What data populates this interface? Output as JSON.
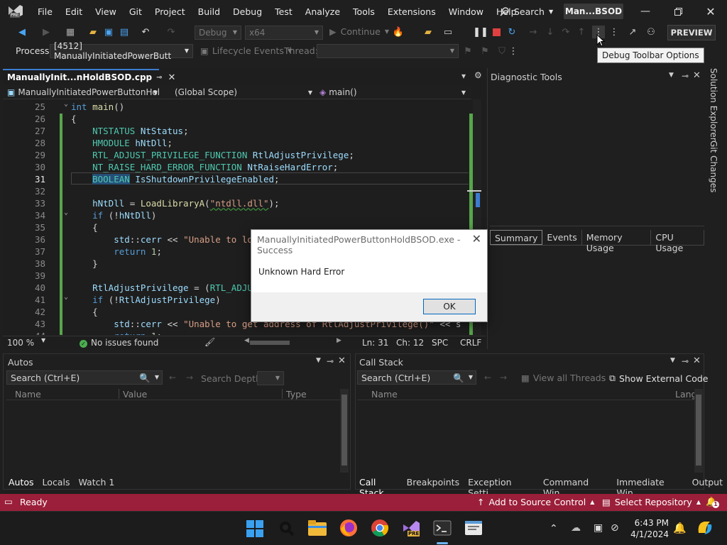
{
  "titlebar": {
    "menu": [
      "File",
      "Edit",
      "View",
      "Git",
      "Project",
      "Build",
      "Debug",
      "Test",
      "Analyze",
      "Tools",
      "Extensions",
      "Window",
      "Help"
    ],
    "search_label": "Search",
    "solution_badge": "Man...BSOD",
    "logo_badge": "PRE"
  },
  "toolbar": {
    "config_combo": "Debug",
    "platform_combo": "x64",
    "continue_label": "Continue",
    "preview_label": "PREVIEW",
    "tooltip": "Debug Toolbar Options"
  },
  "toolbar2": {
    "process_label": "Process:",
    "process_value": "[4512] ManuallyInitiatedPowerButt",
    "lifecycle_label": "Lifecycle Events",
    "thread_label": "Thread:"
  },
  "editor": {
    "tab_label": "ManuallyInit...nHoldBSOD.cpp",
    "nav_project": "ManuallyInitiatedPowerButtonHol",
    "nav_scope": "(Global Scope)",
    "nav_member": "main()",
    "current_line": "31",
    "lines": [
      {
        "n": "25",
        "t": [
          [
            "kw",
            "int"
          ],
          [
            "pl",
            " "
          ],
          [
            "fn",
            "main"
          ],
          [
            "pl",
            "()"
          ]
        ]
      },
      {
        "n": "26",
        "t": [
          [
            "pl",
            "{"
          ]
        ]
      },
      {
        "n": "27",
        "t": [
          [
            "pl",
            "    "
          ],
          [
            "ty",
            "NTSTATUS"
          ],
          [
            "pl",
            " "
          ],
          [
            "id",
            "NtStatus"
          ],
          [
            "pl",
            ";"
          ]
        ]
      },
      {
        "n": "28",
        "t": [
          [
            "pl",
            "    "
          ],
          [
            "ty",
            "HMODULE"
          ],
          [
            "pl",
            " "
          ],
          [
            "id",
            "hNtDll"
          ],
          [
            "pl",
            ";"
          ]
        ]
      },
      {
        "n": "29",
        "t": [
          [
            "pl",
            "    "
          ],
          [
            "ty",
            "RTL_ADJUST_PRIVILEGE_FUNCTION"
          ],
          [
            "pl",
            " "
          ],
          [
            "id",
            "RtlAdjustPrivilege"
          ],
          [
            "pl",
            ";"
          ]
        ]
      },
      {
        "n": "30",
        "t": [
          [
            "pl",
            "    "
          ],
          [
            "ty",
            "NT_RAISE_HARD_ERROR_FUNCTION"
          ],
          [
            "pl",
            " "
          ],
          [
            "id",
            "NtRaiseHardError"
          ],
          [
            "pl",
            ";"
          ]
        ]
      },
      {
        "n": "31",
        "t": [
          [
            "pl",
            "    "
          ],
          [
            "ty",
            "BOOLEAN"
          ],
          [
            "pl",
            " "
          ],
          [
            "id",
            "IsShutdownPrivilegeEnabled"
          ],
          [
            "pl",
            ";"
          ]
        ]
      },
      {
        "n": "32",
        "t": [
          [
            "pl",
            ""
          ]
        ]
      },
      {
        "n": "33",
        "t": [
          [
            "pl",
            "    "
          ],
          [
            "id",
            "hNtDll"
          ],
          [
            "pl",
            " = "
          ],
          [
            "fn",
            "LoadLibraryA"
          ],
          [
            "pl",
            "("
          ],
          [
            "st",
            "\"ntdll.dll\""
          ],
          [
            "pl",
            ");"
          ]
        ]
      },
      {
        "n": "34",
        "t": [
          [
            "pl",
            "    "
          ],
          [
            "kw",
            "if"
          ],
          [
            "pl",
            " (!"
          ],
          [
            "id",
            "hNtDll"
          ],
          [
            "pl",
            ")"
          ]
        ]
      },
      {
        "n": "35",
        "t": [
          [
            "pl",
            "    {"
          ]
        ]
      },
      {
        "n": "36",
        "t": [
          [
            "pl",
            "        "
          ],
          [
            "id",
            "std"
          ],
          [
            "pl",
            "::"
          ],
          [
            "id",
            "cerr"
          ],
          [
            "pl",
            " << "
          ],
          [
            "st",
            "\"Unable to lo"
          ]
        ]
      },
      {
        "n": "37",
        "t": [
          [
            "pl",
            "        "
          ],
          [
            "kw",
            "return"
          ],
          [
            "pl",
            " "
          ],
          [
            "nm",
            "1"
          ],
          [
            "pl",
            ";"
          ]
        ]
      },
      {
        "n": "38",
        "t": [
          [
            "pl",
            "    }"
          ]
        ]
      },
      {
        "n": "39",
        "t": [
          [
            "pl",
            ""
          ]
        ]
      },
      {
        "n": "40",
        "t": [
          [
            "pl",
            "    "
          ],
          [
            "id",
            "RtlAdjustPrivilege"
          ],
          [
            "pl",
            " = ("
          ],
          [
            "ty",
            "RTL_ADJU"
          ]
        ]
      },
      {
        "n": "41",
        "t": [
          [
            "pl",
            "    "
          ],
          [
            "kw",
            "if"
          ],
          [
            "pl",
            " (!"
          ],
          [
            "id",
            "RtlAdjustPrivilege"
          ],
          [
            "pl",
            ")"
          ]
        ]
      },
      {
        "n": "42",
        "t": [
          [
            "pl",
            "    {"
          ]
        ]
      },
      {
        "n": "43",
        "t": [
          [
            "pl",
            "        "
          ],
          [
            "id",
            "std"
          ],
          [
            "pl",
            "::"
          ],
          [
            "id",
            "cerr"
          ],
          [
            "pl",
            " << "
          ],
          [
            "st",
            "\"Unable to get address of RtlAdjustPrivilege()\""
          ],
          [
            "pl",
            " << s"
          ]
        ]
      },
      {
        "n": "44",
        "t": [
          [
            "pl",
            "        "
          ],
          [
            "kw",
            "return"
          ],
          [
            "pl",
            " "
          ],
          [
            "nm",
            "1"
          ],
          [
            "pl",
            ";"
          ]
        ]
      }
    ],
    "zoom": "100 %",
    "issues": "No issues found",
    "ln": "Ln: 31",
    "ch": "Ch: 12",
    "spc": "SPC",
    "crlf": "CRLF"
  },
  "diagnostics": {
    "title": "Diagnostic Tools",
    "tabs": [
      "Summary",
      "Events",
      "Memory Usage",
      "CPU Usage"
    ],
    "rail": [
      "Solution Explorer",
      "Git Changes"
    ]
  },
  "autos": {
    "title": "Autos",
    "search_placeholder": "Search (Ctrl+E)",
    "depth_label": "Search Depth:",
    "columns": [
      "Name",
      "Value",
      "Type"
    ],
    "tabs": [
      "Autos",
      "Locals",
      "Watch 1"
    ]
  },
  "callstack": {
    "title": "Call Stack",
    "search_placeholder": "Search (Ctrl+E)",
    "view_all_threads": "View all Threads",
    "show_external": "Show External Code",
    "columns": [
      "Name",
      "Lang"
    ],
    "tabs": [
      "Call Stack",
      "Breakpoints",
      "Exception Setti...",
      "Command Win...",
      "Immediate Win...",
      "Output"
    ]
  },
  "statusbar": {
    "ready": "Ready",
    "source_control": "Add to Source Control",
    "repository": "Select Repository",
    "notif_count": "1"
  },
  "taskbar": {
    "time": "6:43 PM",
    "date": "4/1/2024",
    "vs_badge": "PRE"
  },
  "dialog": {
    "title": "ManuallyInitiatedPowerButtonHoldBSOD.exe - Success",
    "message": "Unknown Hard Error",
    "ok_label": "OK"
  }
}
